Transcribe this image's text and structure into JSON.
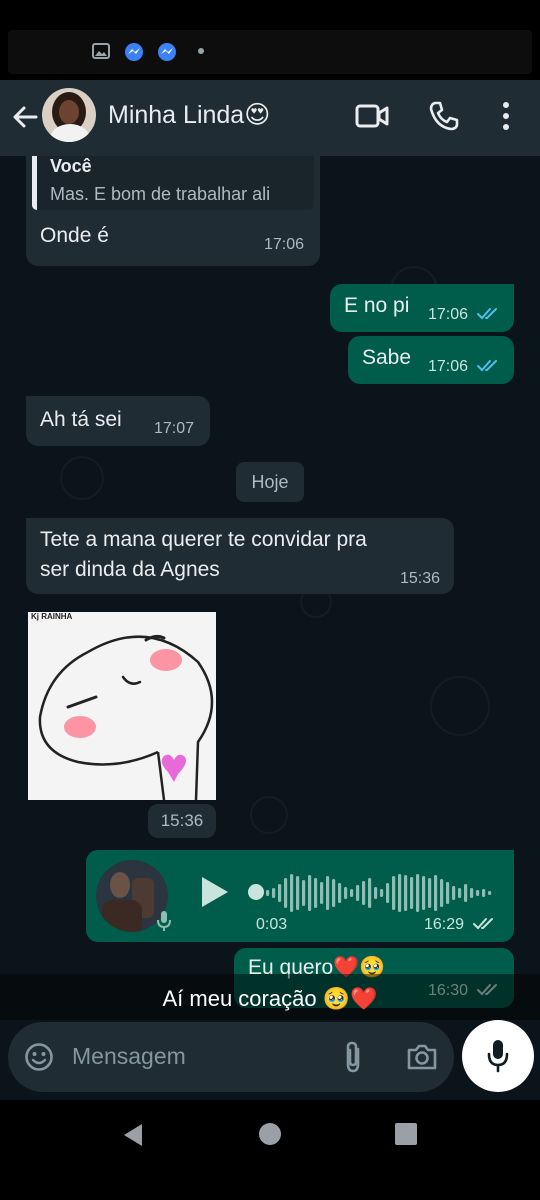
{
  "header": {
    "contact_name": "Minha Linda😍"
  },
  "messages": {
    "quoted_author": "Você",
    "quoted_text": "Mas. E bom de trabalhar ali",
    "reply_text": "Onde é",
    "reply_time": "17:06",
    "out1_text": "E no pi",
    "out1_time": "17:06",
    "out2_text": "Sabe",
    "out2_time": "17:06",
    "in2_text": "Ah tá sei",
    "in2_time": "17:07",
    "day_separator": "Hoje",
    "in3_line1": "Tete a mana querer te convidar pra",
    "in3_line2": "ser dinda da Agnes",
    "in3_time": "15:36",
    "sticker_caption": "Kj RAINHA",
    "sticker_time": "15:36",
    "voice_duration": "0:03",
    "voice_time": "16:29",
    "voice_progress": 0,
    "out3_text": "Eu quero❤️🥹",
    "out3_time": "16:30"
  },
  "overlay_caption": "Aí meu coração 🥹❤️",
  "composer": {
    "placeholder": "Mensagem"
  },
  "colors": {
    "incoming": "#1f2c33",
    "outgoing": "#005c4b",
    "read_tick": "#53bdeb",
    "mic_button": "#ffffff"
  }
}
